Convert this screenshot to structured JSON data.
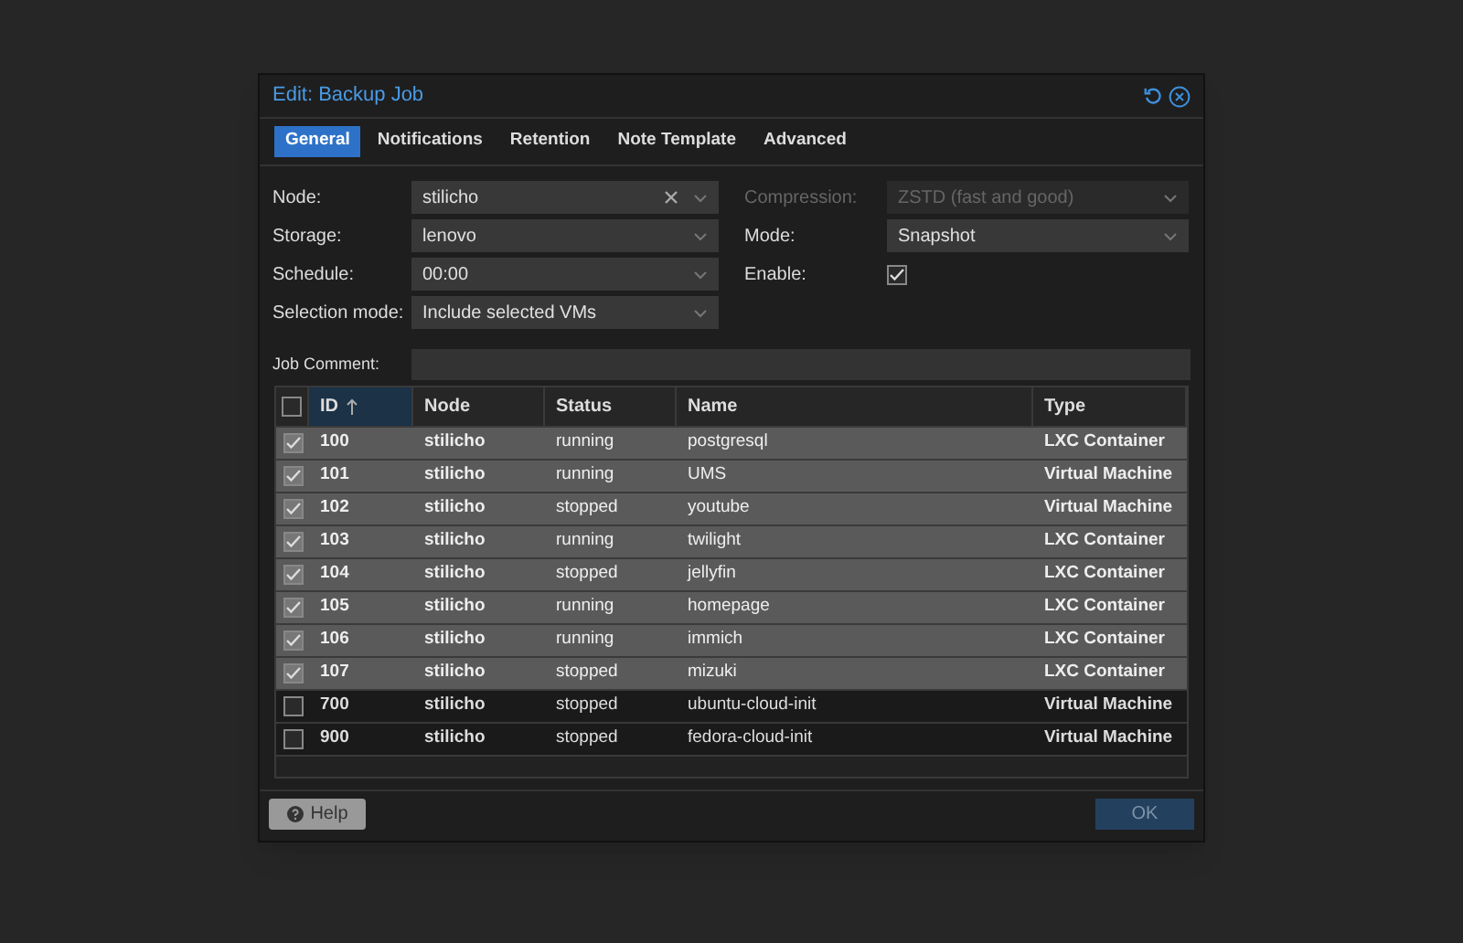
{
  "window": {
    "title": "Edit: Backup Job"
  },
  "tabs": [
    {
      "label": "General",
      "selected": true
    },
    {
      "label": "Notifications",
      "selected": false
    },
    {
      "label": "Retention",
      "selected": false
    },
    {
      "label": "Note Template",
      "selected": false
    },
    {
      "label": "Advanced",
      "selected": false
    }
  ],
  "form_left": [
    {
      "kind": "combo",
      "label": "Node:",
      "value": "stilicho",
      "clearable": true,
      "disabled": false
    },
    {
      "kind": "combo",
      "label": "Storage:",
      "value": "lenovo",
      "clearable": false,
      "disabled": false
    },
    {
      "kind": "combo",
      "label": "Schedule:",
      "value": "00:00",
      "clearable": false,
      "disabled": false
    },
    {
      "kind": "combo",
      "label": "Selection mode:",
      "value": "Include selected VMs",
      "clearable": false,
      "disabled": false
    }
  ],
  "form_right": [
    {
      "kind": "combo",
      "label": "Compression:",
      "value": "ZSTD (fast and good)",
      "clearable": false,
      "disabled": true
    },
    {
      "kind": "combo",
      "label": "Mode:",
      "value": "Snapshot",
      "clearable": false,
      "disabled": false
    },
    {
      "kind": "checkbox",
      "label": "Enable:",
      "checked": true,
      "disabled": false
    }
  ],
  "job_comment": {
    "label": "Job Comment:"
  },
  "table": {
    "all_checked": false,
    "columns": [
      {
        "label": "ID",
        "sorted": true
      },
      {
        "label": "Node",
        "sorted": false
      },
      {
        "label": "Status",
        "sorted": false
      },
      {
        "label": "Name",
        "sorted": false
      },
      {
        "label": "Type",
        "sorted": false
      }
    ],
    "rows": [
      {
        "selected": true,
        "cells": [
          "100",
          "stilicho",
          "running",
          "postgresql",
          "LXC Container"
        ]
      },
      {
        "selected": true,
        "cells": [
          "101",
          "stilicho",
          "running",
          "UMS",
          "Virtual Machine"
        ]
      },
      {
        "selected": true,
        "cells": [
          "102",
          "stilicho",
          "stopped",
          "youtube",
          "Virtual Machine"
        ]
      },
      {
        "selected": true,
        "cells": [
          "103",
          "stilicho",
          "running",
          "twilight",
          "LXC Container"
        ]
      },
      {
        "selected": true,
        "cells": [
          "104",
          "stilicho",
          "stopped",
          "jellyfin",
          "LXC Container"
        ]
      },
      {
        "selected": true,
        "cells": [
          "105",
          "stilicho",
          "running",
          "homepage",
          "LXC Container"
        ]
      },
      {
        "selected": true,
        "cells": [
          "106",
          "stilicho",
          "running",
          "immich",
          "LXC Container"
        ]
      },
      {
        "selected": true,
        "cells": [
          "107",
          "stilicho",
          "stopped",
          "mizuki",
          "LXC Container"
        ]
      },
      {
        "selected": false,
        "cells": [
          "700",
          "stilicho",
          "stopped",
          "ubuntu-cloud-init",
          "Virtual Machine"
        ]
      },
      {
        "selected": false,
        "cells": [
          "900",
          "stilicho",
          "stopped",
          "fedora-cloud-init",
          "Virtual Machine"
        ]
      }
    ]
  },
  "buttons": {
    "help": "Help",
    "ok": "OK"
  }
}
